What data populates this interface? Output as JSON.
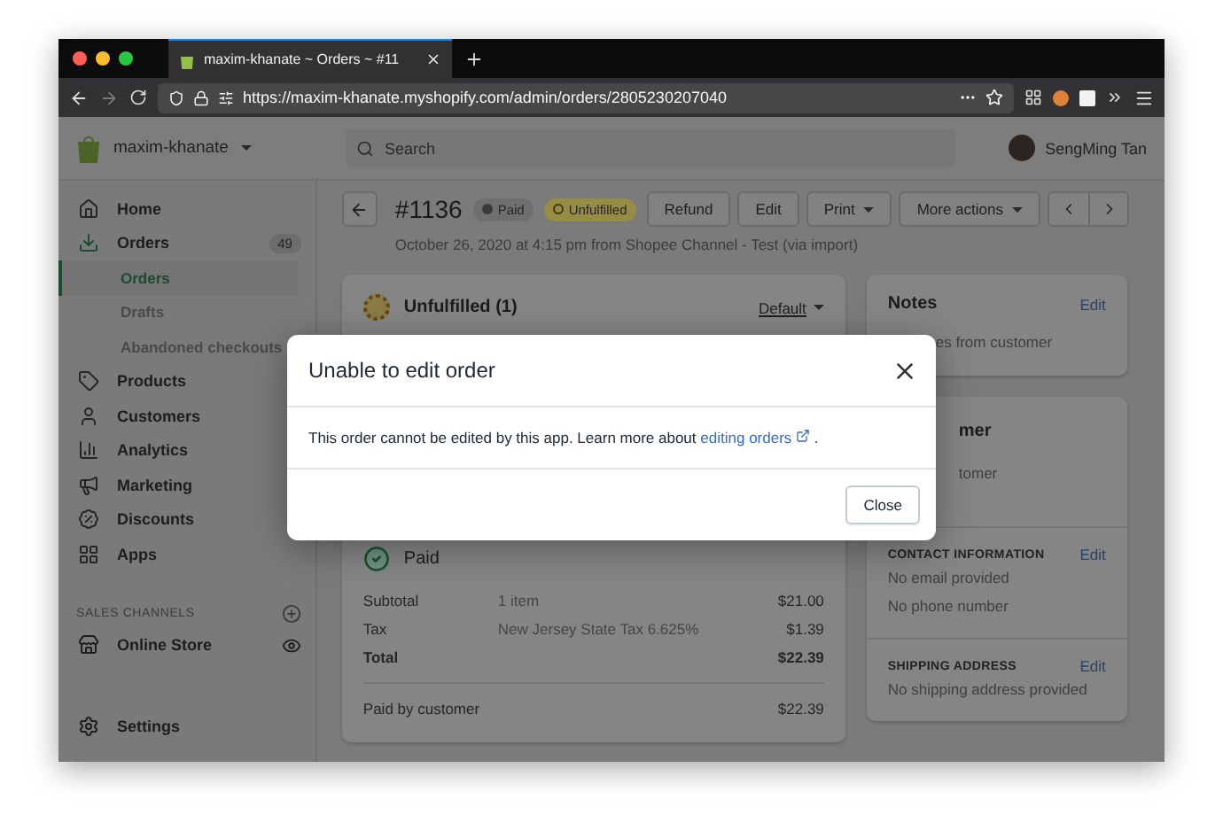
{
  "browser": {
    "tab_title": "maxim-khanate ~ Orders ~ #11",
    "url": "https://maxim-khanate.myshopify.com/admin/orders/2805230207040"
  },
  "topbar": {
    "store_name": "maxim-khanate",
    "search_placeholder": "Search",
    "user_name": "SengMing Tan"
  },
  "sidebar": {
    "items": [
      {
        "label": "Home",
        "selected": false
      },
      {
        "label": "Orders",
        "selected": true,
        "badge": "49",
        "children": [
          {
            "label": "Orders",
            "selected": true
          },
          {
            "label": "Drafts",
            "selected": false
          },
          {
            "label": "Abandoned checkouts",
            "selected": false
          }
        ]
      },
      {
        "label": "Products",
        "selected": false
      },
      {
        "label": "Customers",
        "selected": false
      },
      {
        "label": "Analytics",
        "selected": false
      },
      {
        "label": "Marketing",
        "selected": false
      },
      {
        "label": "Discounts",
        "selected": false
      },
      {
        "label": "Apps",
        "selected": false
      }
    ],
    "sales_channels": {
      "title": "SALES CHANNELS",
      "items": [
        {
          "label": "Online Store"
        }
      ]
    },
    "settings": "Settings"
  },
  "order": {
    "number": "#1136",
    "badges": [
      {
        "label": "Paid",
        "kind": "neutral"
      },
      {
        "label": "Unfulfilled",
        "kind": "attention"
      }
    ],
    "actions": [
      {
        "label": "Refund",
        "dropdown": false
      },
      {
        "label": "Edit",
        "dropdown": false
      },
      {
        "label": "Print",
        "dropdown": true
      },
      {
        "label": "More actions",
        "dropdown": true
      }
    ],
    "date": "October 26, 2020 at 4:15 pm from Shopee Channel - Test (via import)"
  },
  "fulfillment": {
    "title": "Unfulfilled (1)",
    "selector": "Default"
  },
  "payment": {
    "title": "Paid",
    "rows": [
      {
        "label": "Subtotal",
        "detail": "1 item",
        "amount": "$21.00",
        "bold": false
      },
      {
        "label": "Tax",
        "detail": "New Jersey State Tax 6.625%",
        "amount": "$1.39",
        "bold": false
      },
      {
        "label": "Total",
        "amount": "$22.39",
        "bold": true
      }
    ],
    "paid_by": {
      "label": "Paid by customer",
      "amount": "$22.39"
    }
  },
  "notes": {
    "title": "Notes",
    "action": "Edit",
    "text": "es from customer"
  },
  "customer": {
    "title": "mer",
    "text": "tomer",
    "sections": [
      {
        "title": "CONTACT INFORMATION",
        "action": "Edit",
        "lines": [
          "No email provided",
          "No phone number"
        ]
      },
      {
        "title": "SHIPPING ADDRESS",
        "action": "Edit",
        "lines": [
          "No shipping address provided"
        ]
      }
    ]
  },
  "modal": {
    "title": "Unable to edit order",
    "body": "This order cannot be edited by this app. Learn more about",
    "link": "editing orders",
    "tail": ".",
    "button": "Close"
  }
}
